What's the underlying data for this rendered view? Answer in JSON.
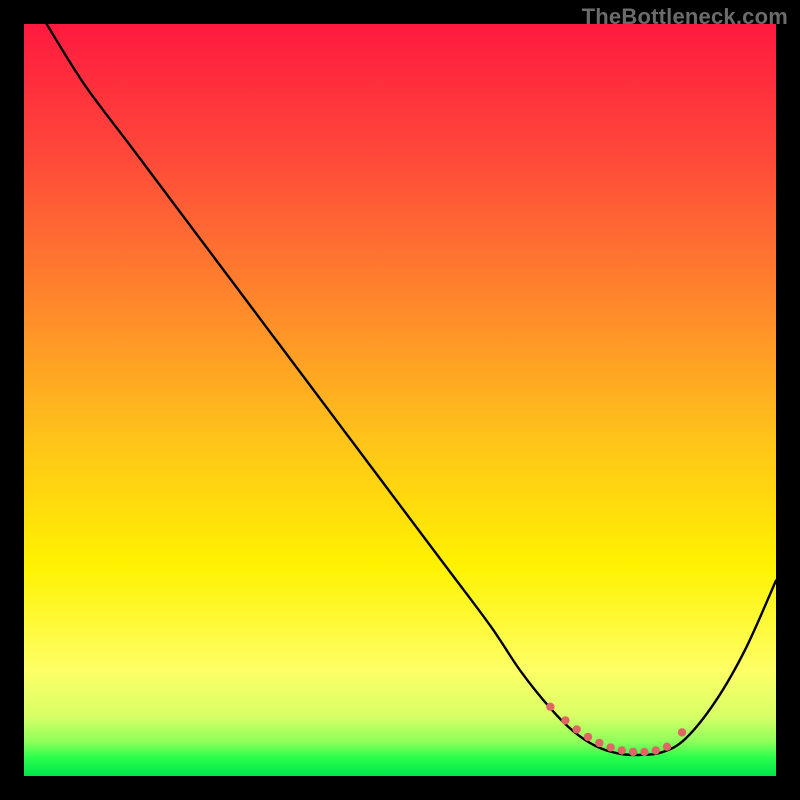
{
  "watermark": "TheBottleneck.com",
  "chart_data": {
    "type": "line",
    "title": "",
    "xlabel": "",
    "ylabel": "",
    "xlim": [
      0,
      100
    ],
    "ylim": [
      0,
      100
    ],
    "grid": false,
    "legend": false,
    "gradient_stops": [
      {
        "offset": 0.0,
        "color": "#ff1a3f"
      },
      {
        "offset": 0.18,
        "color": "#ff4a3a"
      },
      {
        "offset": 0.38,
        "color": "#ff8a2a"
      },
      {
        "offset": 0.55,
        "color": "#ffc31a"
      },
      {
        "offset": 0.72,
        "color": "#fff200"
      },
      {
        "offset": 0.86,
        "color": "#fdff66"
      },
      {
        "offset": 0.92,
        "color": "#d9ff66"
      },
      {
        "offset": 0.955,
        "color": "#8cff5a"
      },
      {
        "offset": 0.975,
        "color": "#2bff4c"
      },
      {
        "offset": 1.0,
        "color": "#00e64a"
      }
    ],
    "series": [
      {
        "name": "bottleneck-curve",
        "color": "#000000",
        "x": [
          3,
          8,
          14,
          20,
          26,
          32,
          38,
          44,
          50,
          56,
          62,
          66,
          70,
          73,
          76,
          79,
          82,
          85,
          88,
          92,
          96,
          100
        ],
        "y": [
          100,
          92,
          84,
          76,
          68,
          60,
          52,
          44,
          36,
          28,
          20,
          14,
          9,
          6,
          4,
          3,
          2.8,
          3.2,
          5,
          10,
          17,
          26
        ]
      }
    ],
    "markers": {
      "name": "optimal-range",
      "color": "#e06666",
      "radius": 4.2,
      "x": [
        70,
        72,
        73.5,
        75,
        76.5,
        78,
        79.5,
        81,
        82.5,
        84,
        85.5,
        87.5
      ],
      "y": [
        9.2,
        7.4,
        6.2,
        5.2,
        4.4,
        3.8,
        3.4,
        3.2,
        3.2,
        3.4,
        3.9,
        5.8
      ]
    }
  }
}
